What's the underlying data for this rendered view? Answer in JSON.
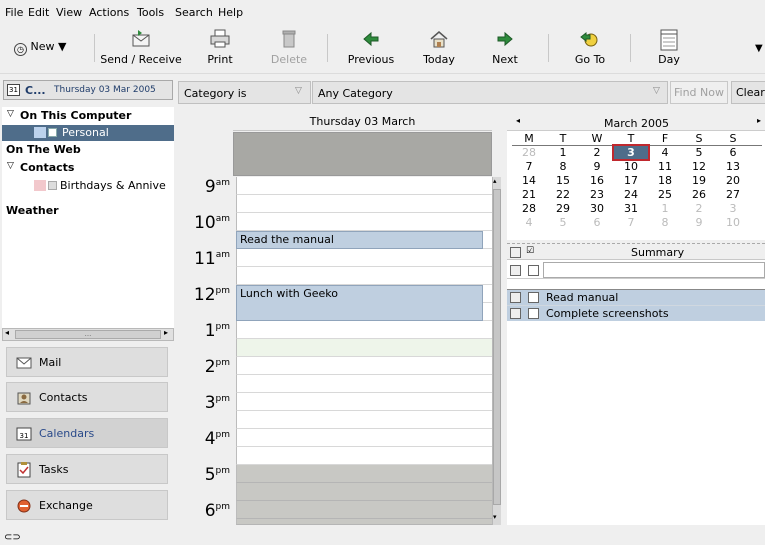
{
  "menu": [
    "File",
    "Edit",
    "View",
    "Actions",
    "Tools",
    "Search",
    "Help"
  ],
  "toolbar": {
    "new": "New",
    "send_receive": "Send / Receive",
    "print": "Print",
    "delete": "Delete",
    "previous": "Previous",
    "today": "Today",
    "next": "Next",
    "goto": "Go To",
    "day": "Day"
  },
  "left_header": {
    "title": "C...",
    "date": "Thursday 03 Mar 2005"
  },
  "tree": {
    "on_this_computer": "On This Computer",
    "personal": "Personal",
    "on_the_web": "On The Web",
    "contacts": "Contacts",
    "birthdays": "Birthdays & Annive",
    "weather": "Weather"
  },
  "scroll_dots": "...",
  "nav": {
    "mail": "Mail",
    "contacts": "Contacts",
    "calendars": "Calendars",
    "tasks": "Tasks",
    "exchange": "Exchange"
  },
  "filter": {
    "field": "Category is",
    "value": "Any Category",
    "find_now": "Find Now",
    "clear": "Clear"
  },
  "day_view": {
    "header": "Thursday 03 March",
    "hours": [
      {
        "h": "9",
        "ampm": "am"
      },
      {
        "h": "10",
        "ampm": "am"
      },
      {
        "h": "11",
        "ampm": "am"
      },
      {
        "h": "12",
        "ampm": "pm"
      },
      {
        "h": "1",
        "ampm": "pm"
      },
      {
        "h": "2",
        "ampm": "pm"
      },
      {
        "h": "3",
        "ampm": "pm"
      },
      {
        "h": "4",
        "ampm": "pm"
      },
      {
        "h": "5",
        "ampm": "pm"
      },
      {
        "h": "6",
        "ampm": "pm"
      }
    ],
    "appointments": [
      {
        "title": "Read the manual"
      },
      {
        "title": "Lunch with Geeko"
      }
    ]
  },
  "mini_calendar": {
    "month": "March 2005",
    "weekdays": [
      "M",
      "T",
      "W",
      "T",
      "F",
      "S",
      "S"
    ],
    "weeks": [
      [
        "28",
        "1",
        "2",
        "3",
        "4",
        "5",
        "6"
      ],
      [
        "7",
        "8",
        "9",
        "10",
        "11",
        "12",
        "13"
      ],
      [
        "14",
        "15",
        "16",
        "17",
        "18",
        "19",
        "20"
      ],
      [
        "21",
        "22",
        "23",
        "24",
        "25",
        "26",
        "27"
      ],
      [
        "28",
        "29",
        "30",
        "31",
        "1",
        "2",
        "3"
      ],
      [
        "4",
        "5",
        "6",
        "7",
        "8",
        "9",
        "10"
      ]
    ],
    "selected": "3"
  },
  "tasks": {
    "header_summary": "Summary",
    "items": [
      {
        "summary": "Read manual"
      },
      {
        "summary": "Complete screenshots"
      }
    ]
  },
  "colors": {
    "selection": "#4f6d8a",
    "appointment": "#bfcfe0",
    "today_box": "#c0282e"
  }
}
